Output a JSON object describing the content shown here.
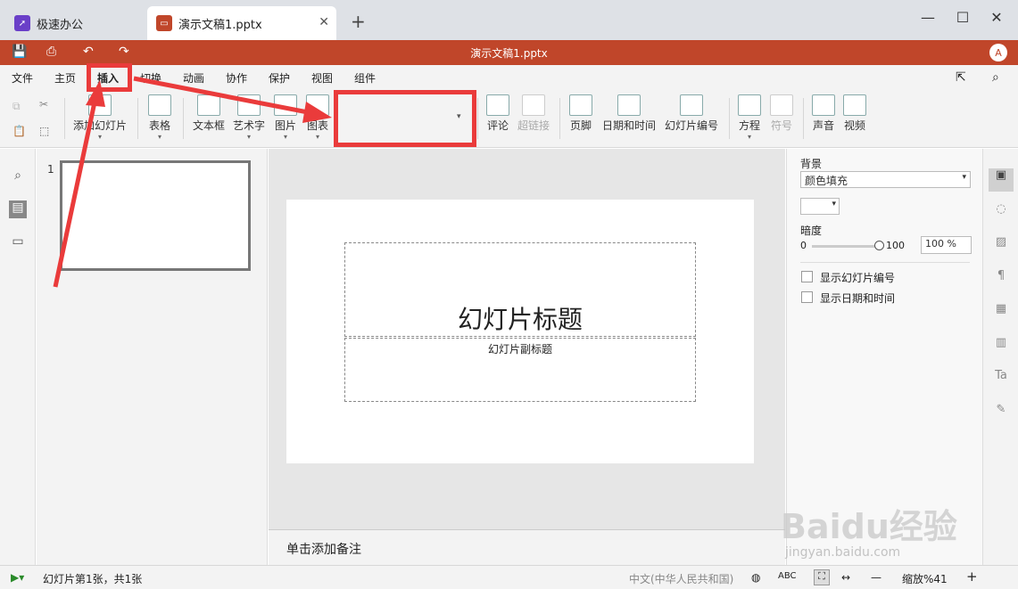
{
  "tabs": {
    "app": "极速办公",
    "document": "演示文稿1.pptx",
    "add": "+"
  },
  "window": {
    "title": "演示文稿1.pptx",
    "avatar": "A"
  },
  "menu": [
    "文件",
    "主页",
    "插入",
    "切换",
    "动画",
    "协作",
    "保护",
    "视图",
    "组件"
  ],
  "toolbar": {
    "add_slide": "添加幻灯片",
    "table": "表格",
    "textbox": "文本框",
    "wordart": "艺术字",
    "image": "图片",
    "chart": "图表",
    "comment": "评论",
    "hyperlink": "超链接",
    "footer": "页脚",
    "datetime": "日期和时间",
    "slide_number": "幻灯片编号",
    "equation": "方程",
    "symbol": "符号",
    "audio": "声音",
    "video": "视频"
  },
  "thumbnail": {
    "index": "1"
  },
  "slide": {
    "title": "幻灯片标题",
    "subtitle": "幻灯片副标题"
  },
  "notes_placeholder": "单击添加备注",
  "right_panel": {
    "background_label": "背景",
    "fill_type": "颜色填充",
    "transparency_label": "暗度",
    "slider_min": "0",
    "slider_max": "100",
    "opacity_value": "100 %",
    "show_slide_number": "显示幻灯片编号",
    "show_datetime": "显示日期和时间"
  },
  "status": {
    "slide_info": "幻灯片第1张，共1张",
    "language": "中文(中华人民共和国)",
    "zoom": "缩放%41"
  },
  "watermark": {
    "brand": "Baidu经验",
    "url": "jingyan.baidu.com"
  },
  "colors": {
    "accent": "#c0462a",
    "annotation": "#ea3b3b"
  }
}
